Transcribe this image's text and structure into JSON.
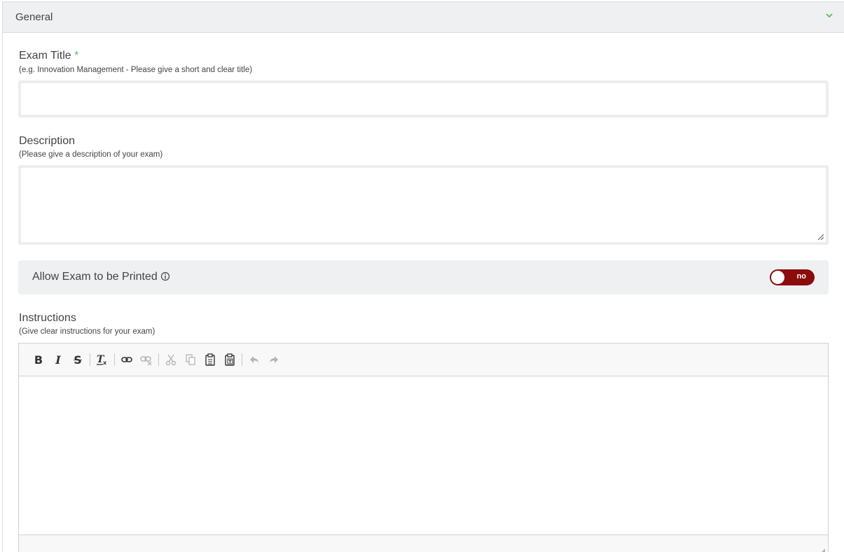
{
  "panel": {
    "title": "General",
    "accent_color": "#5cb85c"
  },
  "exam_title": {
    "label": "Exam Title",
    "required_mark": "*",
    "hint": "(e.g. Innovation Management - Please give a short and clear title)",
    "value": ""
  },
  "description": {
    "label": "Description",
    "hint": "(Please give a description of your exam)",
    "value": ""
  },
  "print_toggle": {
    "label": "Allow Exam to be Printed",
    "state_text": "no",
    "color": "#8b0c0c"
  },
  "instructions": {
    "label": "Instructions",
    "hint": "(Give clear instructions for your exam)",
    "toolbar": [
      {
        "name": "bold",
        "glyph": "B"
      },
      {
        "name": "italic",
        "glyph": "I"
      },
      {
        "name": "strikethrough",
        "glyph": "S"
      },
      {
        "name": "remove-format",
        "glyph": "Tx"
      },
      {
        "name": "link",
        "glyph": "link"
      },
      {
        "name": "unlink",
        "glyph": "unlink"
      },
      {
        "name": "cut",
        "glyph": "cut"
      },
      {
        "name": "copy",
        "glyph": "copy"
      },
      {
        "name": "paste",
        "glyph": "paste"
      },
      {
        "name": "paste-text",
        "glyph": "paste-text"
      },
      {
        "name": "undo",
        "glyph": "undo"
      },
      {
        "name": "redo",
        "glyph": "redo"
      }
    ]
  }
}
